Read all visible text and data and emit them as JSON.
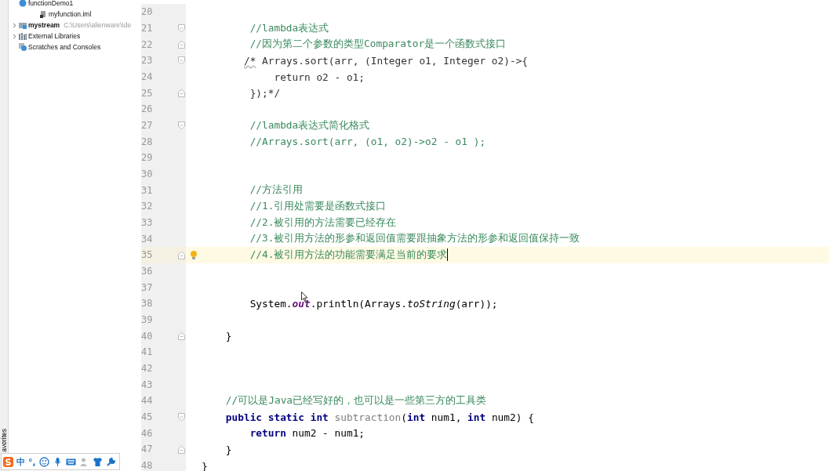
{
  "project_tree": {
    "items": [
      {
        "label": "functionDemo1",
        "kind": "class"
      },
      {
        "label": "myfunction.iml",
        "kind": "file"
      },
      {
        "label": "mystream",
        "path": "C:\\Users\\alienware\\Ide",
        "kind": "module",
        "expanded": false
      },
      {
        "label": "External Libraries",
        "kind": "libraries",
        "expanded": false
      },
      {
        "label": "Scratches and Consoles",
        "kind": "scratches"
      }
    ]
  },
  "side_tab": {
    "label": "avorites"
  },
  "ime_toolbar": {
    "mode": "中",
    "punctuation": "°,"
  },
  "editor": {
    "lines": [
      {
        "number": "20",
        "kind": "plain"
      },
      {
        "number": "21",
        "kind": "fold-start",
        "tokens": [
          {
            "kind": "comment",
            "text": "        //lambda表达式"
          }
        ]
      },
      {
        "number": "22",
        "kind": "fold-end",
        "tokens": [
          {
            "kind": "comment",
            "text": "        //因为第二个参数的类型Comparator是一个函数式接口"
          }
        ]
      },
      {
        "number": "23",
        "kind": "fold-start",
        "tokens": [
          {
            "kind": "warning",
            "text": "       /*"
          },
          {
            "kind": "block",
            "text": " Arrays.sort(arr, (Integer o1, Integer o2)->{"
          }
        ]
      },
      {
        "number": "24",
        "kind": "plain",
        "tokens": [
          {
            "kind": "block",
            "text": "            return o2 - o1;"
          }
        ]
      },
      {
        "number": "25",
        "kind": "fold-end",
        "tokens": [
          {
            "kind": "block",
            "text": "        });*/"
          }
        ]
      },
      {
        "number": "26",
        "kind": "plain"
      },
      {
        "number": "27",
        "kind": "fold-start",
        "tokens": [
          {
            "kind": "comment",
            "text": "        //lambda表达式简化格式"
          }
        ]
      },
      {
        "number": "28",
        "kind": "plain",
        "tokens": [
          {
            "kind": "comment",
            "text": "        //Arrays.sort(arr, (o1, o2)->o2 - o1 );"
          }
        ]
      },
      {
        "number": "29",
        "kind": "plain"
      },
      {
        "number": "30",
        "kind": "plain"
      },
      {
        "number": "31",
        "kind": "plain",
        "tokens": [
          {
            "kind": "comment",
            "text": "        //方法引用"
          }
        ]
      },
      {
        "number": "32",
        "kind": "plain",
        "tokens": [
          {
            "kind": "comment",
            "text": "        //1.引用处需要是函数式接口"
          }
        ]
      },
      {
        "number": "33",
        "kind": "plain",
        "tokens": [
          {
            "kind": "comment",
            "text": "        //2.被引用的方法需要已经存在"
          }
        ]
      },
      {
        "number": "34",
        "kind": "plain",
        "tokens": [
          {
            "kind": "comment",
            "text": "        //3.被引用方法的形参和返回值需要跟抽象方法的形参和返回值保持一致"
          }
        ]
      },
      {
        "number": "35",
        "kind": "fold-end",
        "current": true,
        "bulb": true,
        "caret": true,
        "tokens": [
          {
            "kind": "comment",
            "text": "        //4.被引用方法的功能需要满足当前的要求"
          }
        ]
      },
      {
        "number": "36",
        "kind": "plain"
      },
      {
        "number": "37",
        "kind": "plain"
      },
      {
        "number": "38",
        "kind": "plain",
        "tokens": [
          {
            "kind": "plain",
            "text": "        System."
          },
          {
            "kind": "field",
            "text": "out"
          },
          {
            "kind": "plain",
            "text": ".println(Arrays."
          },
          {
            "kind": "static",
            "text": "toString"
          },
          {
            "kind": "plain",
            "text": "(arr));"
          }
        ]
      },
      {
        "number": "39",
        "kind": "plain"
      },
      {
        "number": "40",
        "kind": "fold-end",
        "tokens": [
          {
            "kind": "plain",
            "text": "    }"
          }
        ]
      },
      {
        "number": "41",
        "kind": "plain"
      },
      {
        "number": "42",
        "kind": "plain"
      },
      {
        "number": "43",
        "kind": "plain"
      },
      {
        "number": "44",
        "kind": "plain",
        "tokens": [
          {
            "kind": "comment",
            "text": "    //可以是Java已经写好的，也可以是一些第三方的工具类"
          }
        ]
      },
      {
        "number": "45",
        "kind": "fold-start",
        "tokens": [
          {
            "kind": "keyword",
            "text": "    public static int "
          },
          {
            "kind": "unused",
            "text": "subtraction"
          },
          {
            "kind": "plain",
            "text": "("
          },
          {
            "kind": "keyword",
            "text": "int"
          },
          {
            "kind": "plain",
            "text": " num1, "
          },
          {
            "kind": "keyword",
            "text": "int"
          },
          {
            "kind": "plain",
            "text": " num2) {"
          }
        ]
      },
      {
        "number": "46",
        "kind": "plain",
        "tokens": [
          {
            "kind": "keyword",
            "text": "        return"
          },
          {
            "kind": "plain",
            "text": " num2 - num1;"
          }
        ]
      },
      {
        "number": "47",
        "kind": "fold-end",
        "tokens": [
          {
            "kind": "plain",
            "text": "    }"
          }
        ]
      },
      {
        "number": "48",
        "kind": "plain",
        "tokens": [
          {
            "kind": "plain",
            "text": "}"
          }
        ]
      }
    ]
  }
}
